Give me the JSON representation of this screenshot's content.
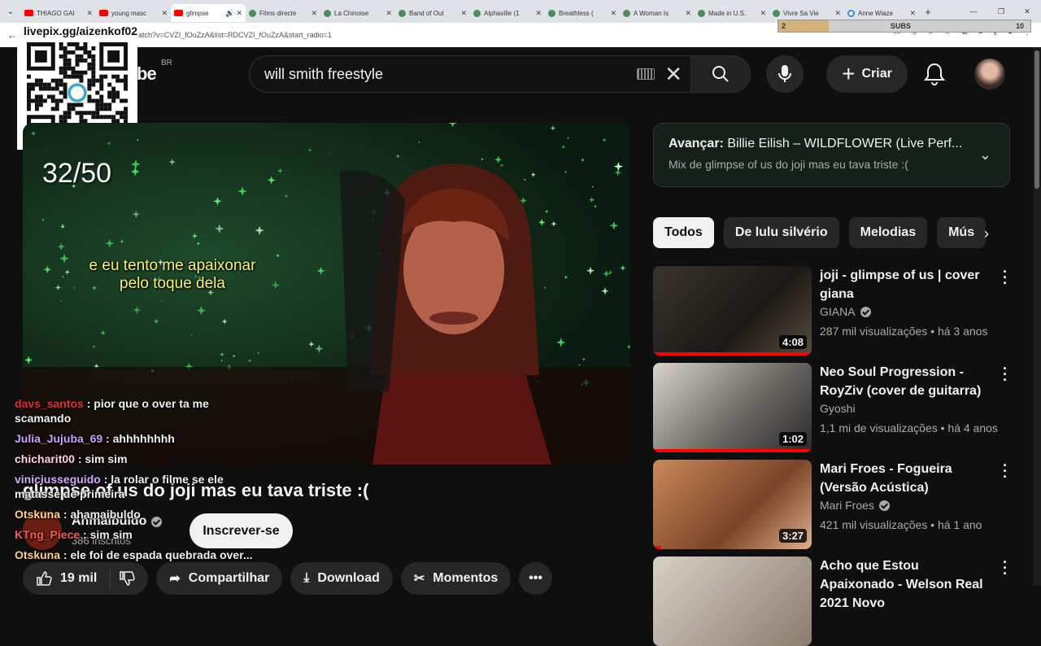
{
  "browser": {
    "tabs": [
      {
        "title": "THIAGO GAI",
        "fav": "yt"
      },
      {
        "title": "young masc",
        "fav": "yt"
      },
      {
        "title": "glimpse",
        "fav": "yt",
        "active": true
      },
      {
        "title": "Films directe",
        "fav": "glb"
      },
      {
        "title": "La Chinoise",
        "fav": "glb"
      },
      {
        "title": "Band of Out",
        "fav": "glb"
      },
      {
        "title": "Alphaville (1",
        "fav": "glb"
      },
      {
        "title": "Breathless (",
        "fav": "glb"
      },
      {
        "title": "A Woman Is",
        "fav": "glb"
      },
      {
        "title": "Made in U.S.",
        "fav": "glb"
      },
      {
        "title": "Vivre Sa Vie",
        "fav": "glb"
      },
      {
        "title": "Anne Wiaze",
        "fav": "g"
      }
    ],
    "url": "atch?v=CVZI_fOuZzA&list=RDCVZI_fOuZzA&start_radio=1"
  },
  "overlay": {
    "qr_text": "livepix.gg/aizenkof02",
    "subs_label": "SUBS",
    "subs_left": "2",
    "subs_right": "10",
    "subs_fraction": 0.2,
    "counter": "32/50",
    "lyric_line1": "e eu tento me apaixonar",
    "lyric_line2": "pelo toque dela"
  },
  "header": {
    "logo_tail": "be",
    "country": "BR",
    "search_query": "will smith freestyle",
    "create_label": "Criar"
  },
  "video": {
    "title": "glimpse of us do joji mas eu tava triste :(",
    "channel": "Ahmaibuldo",
    "channel_subs": "386 inscritos",
    "subscribe_label": "Inscrever-se",
    "likes": "19 mil",
    "share_label": "Compartilhar",
    "download_label": "Download",
    "moments_label": "Momentos"
  },
  "chat": [
    {
      "user": "davs_santos",
      "msg": ": pior que o over ta me scamando",
      "color": "#e03131"
    },
    {
      "user": "Julia_Jujuba_69",
      "msg": ": ahhhhhhhh",
      "color": "#c9a0ff"
    },
    {
      "user": "chicharit00",
      "msg": ": sim sim",
      "color": "#ffd1e8"
    },
    {
      "user": "viniciusseguido",
      "msg": ": la rolar o filme se ele matasse de primeira",
      "color": "#d6a8ff"
    },
    {
      "user": "Otskuna",
      "msg": ": ahamaibuldo",
      "color": "#ffd08a"
    },
    {
      "user": "KTng_Piece",
      "msg": ": sim sim",
      "color": "#ff5a4d"
    },
    {
      "user": "Otskuna",
      "msg": ": ele foi de espada quebrada over...",
      "color": "#ffd08a"
    }
  ],
  "upnext": {
    "prefix": "Avançar:",
    "title": "Billie Eilish – WILDFLOWER (Live Perf...",
    "subtitle": "Mix de glimpse of us do joji mas eu tava triste :("
  },
  "chips": [
    "Todos",
    "De lulu silvério",
    "Melodias",
    "Mús"
  ],
  "recommendations": [
    {
      "title": "joji - glimpse of us | cover giana",
      "channel": "GIANA",
      "verified": true,
      "meta": "287 mil visualizações • há 3 anos",
      "duration": "4:08",
      "progress": 1.0
    },
    {
      "title": "Neo Soul Progression - RoyZiv (cover de guitarra)",
      "channel": "Gyoshi",
      "verified": false,
      "meta": "1,1 mi de visualizações • há 4 anos",
      "duration": "1:02",
      "progress": 1.0
    },
    {
      "title": "Mari Froes - Fogueira (Versão Acústica)",
      "channel": "Mari Froes",
      "verified": true,
      "meta": "421 mil visualizações • há 1 ano",
      "duration": "3:27",
      "progress": 0.05
    },
    {
      "title": "Acho que Estou Apaixonado - Welson Real 2021 Novo",
      "channel": "",
      "verified": false,
      "meta": "",
      "duration": "",
      "progress": 0
    }
  ]
}
